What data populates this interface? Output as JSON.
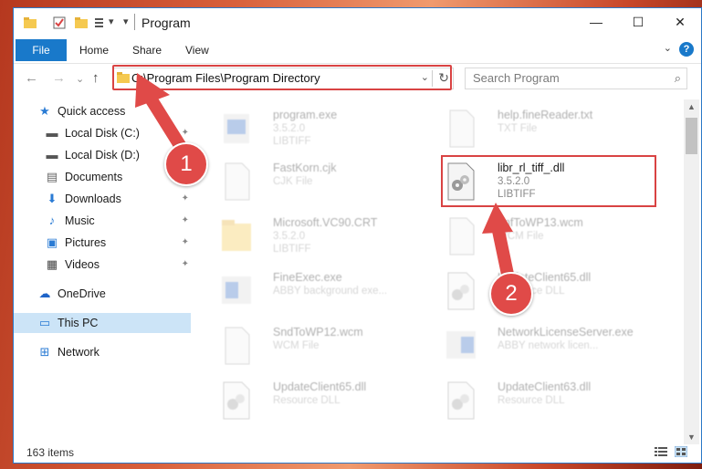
{
  "window": {
    "title": "Program",
    "quick_access_dropdown": "▾",
    "minimize": "—",
    "maximize": "☐",
    "close": "✕"
  },
  "ribbon": {
    "file": "File",
    "home": "Home",
    "share": "Share",
    "view": "View",
    "collapse": "⌄",
    "help": "?"
  },
  "navigation": {
    "back": "←",
    "forward": "→",
    "recent": "⌄",
    "up": "↑"
  },
  "address": {
    "path": "C:\\Program Files\\Program Directory",
    "dropdown": "⌄",
    "refresh": "↻"
  },
  "search": {
    "placeholder": "Search Program",
    "icon": "⌕"
  },
  "sidebar": {
    "items": [
      {
        "label": "Quick access",
        "icon": "★"
      },
      {
        "label": "Local Disk (C:)",
        "icon": "▬"
      },
      {
        "label": "Local Disk (D:)",
        "icon": "▬"
      },
      {
        "label": "Documents",
        "icon": "▤"
      },
      {
        "label": "Downloads",
        "icon": "⬇"
      },
      {
        "label": "Music",
        "icon": "♪"
      },
      {
        "label": "Pictures",
        "icon": "▣"
      },
      {
        "label": "Videos",
        "icon": "▦"
      },
      {
        "label": "OneDrive",
        "icon": "☁"
      },
      {
        "label": "This PC",
        "icon": "▭"
      },
      {
        "label": "Network",
        "icon": "⊞"
      }
    ],
    "pin": "✦"
  },
  "files": [
    {
      "name": "program.exe",
      "line1": "3.5.2.0",
      "line2": "LIBTIFF"
    },
    {
      "name": "help.fineReader.txt",
      "line1": "TXT File",
      "line2": ""
    },
    {
      "name": "FastKorn.cjk",
      "line1": "CJK File",
      "line2": ""
    },
    {
      "name": "libr_rl_tiff_.dll",
      "line1": "3.5.2.0",
      "line2": "LIBTIFF"
    },
    {
      "name": "Microsoft.VC90.CRT",
      "line1": "3.5.2.0",
      "line2": "LIBTIFF"
    },
    {
      "name": "ImfToWP13.wcm",
      "line1": "WCM File",
      "line2": ""
    },
    {
      "name": "FineExec.exe",
      "line1": "ABBY background exe...",
      "line2": ""
    },
    {
      "name": "UpdateClient65.dll",
      "line1": "Resource DLL",
      "line2": ""
    },
    {
      "name": "SndToWP12.wcm",
      "line1": "WCM File",
      "line2": ""
    },
    {
      "name": "NetworkLicenseServer.exe",
      "line1": "ABBY network licen...",
      "line2": ""
    },
    {
      "name": "UpdateClient65.dll",
      "line1": "Resource DLL",
      "line2": ""
    },
    {
      "name": "UpdateClient63.dll",
      "line1": "Resource DLL",
      "line2": ""
    }
  ],
  "status": {
    "items_count": "163 items"
  },
  "callouts": {
    "one": "1",
    "two": "2"
  },
  "colors": {
    "accent": "#1979ca",
    "highlight_red": "#d94343",
    "callout": "#e04a48"
  }
}
